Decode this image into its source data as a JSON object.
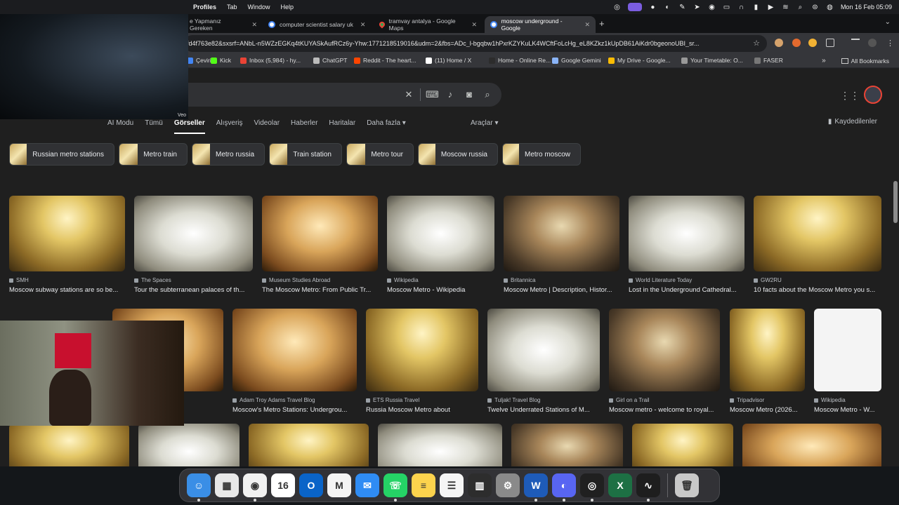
{
  "menubar": {
    "menus": [
      "Profiles",
      "Tab",
      "Window",
      "Help"
    ],
    "clock": "Mon 16 Feb  05:09"
  },
  "tabs": [
    {
      "label": "e Yapmanız Gereken",
      "icon": "google-icon"
    },
    {
      "label": "computer scientist salary uk",
      "icon": "google-icon"
    },
    {
      "label": "tramvay antalya - Google Maps",
      "icon": "maps-icon"
    },
    {
      "label": "moscow underground - Google",
      "icon": "google-icon",
      "active": true
    }
  ],
  "address_bar": {
    "url": "fd4f763e82&sxsrf=ANbL-n5WZzEGKq4tKUYASkAufRCz6y-Yhw:1771218519016&udm=2&fbs=ADc_l-bgqbw1hPxrKZYKuLK4WCftFoLcHg_eL8KZkz1kUpDB61AiKdr0bgeonoUBI_sr..."
  },
  "bookmarks": [
    {
      "label": "Çeviri",
      "color": "#4285f4"
    },
    {
      "label": "Kick",
      "color": "#53fc18"
    },
    {
      "label": "Inbox (5,984) - hy...",
      "color": "#ea4335"
    },
    {
      "label": "ChatGPT",
      "color": "#bbbbbb"
    },
    {
      "label": "Reddit - The heart...",
      "color": "#ff4500"
    },
    {
      "label": "(11) Home / X",
      "color": "#ffffff"
    },
    {
      "label": "Home - Online Re...",
      "color": "#2c2c2c"
    },
    {
      "label": "Google Gemini",
      "color": "#8ab4f8"
    },
    {
      "label": "My Drive - Google...",
      "color": "#fbbc04"
    },
    {
      "label": "Your Timetable: O...",
      "color": "#999999"
    },
    {
      "label": "FASER",
      "color": "#777777"
    }
  ],
  "all_bookmarks": "All Bookmarks",
  "search_nav": {
    "items": [
      "AI Modu",
      "Tümü",
      "Görseller",
      "Alışveriş",
      "Videolar",
      "Haberler",
      "Haritalar",
      "Daha fazla"
    ],
    "active": "Görseller",
    "tools": "Araçlar",
    "saved": "Kaydedilenler"
  },
  "chips": [
    "Russian metro stations",
    "Metro train",
    "Metro russia",
    "Train station",
    "Metro tour",
    "Moscow russia",
    "Metro moscow"
  ],
  "results_row1": [
    {
      "source": "SMH",
      "title": "Moscow subway stations are so be...",
      "style": "g-gold"
    },
    {
      "source": "The Spaces",
      "title": "Tour the subterranean palaces of th...",
      "style": "g-white"
    },
    {
      "source": "Museum Studies Abroad",
      "title": "The Moscow Metro: From Public Tr...",
      "style": "g-warm"
    },
    {
      "source": "Wikipedia",
      "title": "Moscow Metro - Wikipedia",
      "style": "g-white"
    },
    {
      "source": "Britannica",
      "title": "Moscow Metro | Description, Histor...",
      "style": "g-dark"
    },
    {
      "source": "World Literature Today",
      "title": "Lost in the Underground Cathedral...",
      "style": "g-white"
    },
    {
      "source": "GW2RU",
      "title": "10 facts about the Moscow Metro you s...",
      "style": "g-gold"
    }
  ],
  "results_row2": [
    {
      "source": "",
      "title": "ips for Tra...",
      "style": "g-warm"
    },
    {
      "source": "Adam Troy Adams Travel Blog",
      "title": "Moscow's Metro Stations: Undergrou...",
      "style": "g-warm"
    },
    {
      "source": "ETS Russia Travel",
      "title": "Russia Moscow Metro about",
      "style": "g-gold"
    },
    {
      "source": "Tuljak! Travel Blog",
      "title": "Twelve Underrated Stations of M...",
      "style": "g-white"
    },
    {
      "source": "Girl on a Trail",
      "title": "Moscow metro - welcome to royal...",
      "style": "g-dark"
    },
    {
      "source": "Tripadvisor",
      "title": "Moscow Metro (2026...",
      "style": "g-gold"
    },
    {
      "source": "Wikipedia",
      "title": "Moscow Metro - W...",
      "style": "g-map"
    }
  ],
  "results_row3": [
    {
      "style": "g-gold"
    },
    {
      "style": "g-white"
    },
    {
      "style": "g-gold"
    },
    {
      "style": "g-white"
    },
    {
      "style": "g-dark"
    },
    {
      "style": "g-gold"
    },
    {
      "style": "g-warm"
    }
  ],
  "webcam_label": "Veo",
  "dock_apps": [
    {
      "name": "Finder",
      "glyph": "☺",
      "color": "#3a8ee6",
      "running": true
    },
    {
      "name": "Launchpad",
      "glyph": "▦",
      "color": "#e8e8e8",
      "running": false
    },
    {
      "name": "Chrome",
      "glyph": "◉",
      "color": "#f1f1f1",
      "running": true
    },
    {
      "name": "Calendar",
      "glyph": "16",
      "color": "#ffffff",
      "running": false
    },
    {
      "name": "Outlook",
      "glyph": "O",
      "color": "#0a64c8",
      "running": false
    },
    {
      "name": "Gmail",
      "glyph": "M",
      "color": "#f4f4f4",
      "running": false
    },
    {
      "name": "Mail",
      "glyph": "✉",
      "color": "#2f8cf4",
      "running": false
    },
    {
      "name": "WhatsApp",
      "glyph": "☏",
      "color": "#25d366",
      "running": true
    },
    {
      "name": "Notes",
      "glyph": "≡",
      "color": "#fcd34d",
      "running": false
    },
    {
      "name": "Reminders",
      "glyph": "☰",
      "color": "#f5f5f5",
      "running": false
    },
    {
      "name": "Keynote",
      "glyph": "▥",
      "color": "#2d2d2d",
      "running": false
    },
    {
      "name": "System Settings",
      "glyph": "⚙",
      "color": "#8a8a8a",
      "running": false
    },
    {
      "name": "Word",
      "glyph": "W",
      "color": "#1e5bb8",
      "running": true
    },
    {
      "name": "Discord",
      "glyph": "◐",
      "color": "#5865f2",
      "running": true
    },
    {
      "name": "OBS",
      "glyph": "◎",
      "color": "#202020",
      "running": true
    },
    {
      "name": "Excel",
      "glyph": "X",
      "color": "#1d7044",
      "running": false
    },
    {
      "name": "Activity Monitor",
      "glyph": "∿",
      "color": "#1e1e1e",
      "running": true
    },
    {
      "name": "Trash",
      "glyph": "🗑",
      "color": "#c8c8c8",
      "running": false
    }
  ]
}
